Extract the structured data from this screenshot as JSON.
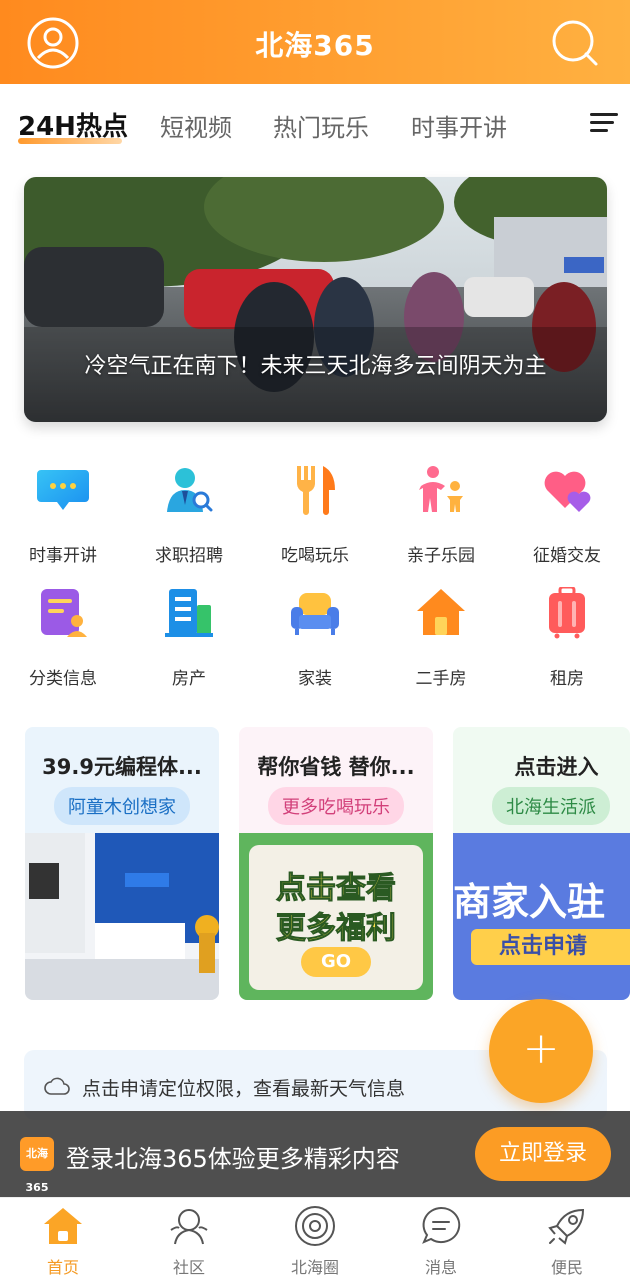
{
  "header": {
    "title": "北海365",
    "icons": [
      "user-icon",
      "search-icon"
    ]
  },
  "tabs": {
    "items": [
      {
        "label": "24H热点",
        "active": true
      },
      {
        "label": "短视频",
        "active": false
      },
      {
        "label": "热门玩乐",
        "active": false
      },
      {
        "label": "时事开讲",
        "active": false
      }
    ],
    "menu_icon": "menu-icon"
  },
  "banner": {
    "caption": "冷空气正在南下！未来三天北海多云间阴天为主"
  },
  "categories": [
    {
      "label": "时事开讲",
      "icon": "chat-bubble-icon"
    },
    {
      "label": "求职招聘",
      "icon": "job-search-icon"
    },
    {
      "label": "吃喝玩乐",
      "icon": "fork-knife-icon"
    },
    {
      "label": "亲子乐园",
      "icon": "parent-child-icon"
    },
    {
      "label": "征婚交友",
      "icon": "hearts-icon"
    },
    {
      "label": "分类信息",
      "icon": "classified-icon"
    },
    {
      "label": "房产",
      "icon": "building-icon"
    },
    {
      "label": "家装",
      "icon": "sofa-icon"
    },
    {
      "label": "二手房",
      "icon": "house-icon"
    },
    {
      "label": "租房",
      "icon": "luggage-icon"
    }
  ],
  "promos": [
    {
      "title": "39.9元编程体...",
      "tag": "阿童木创想家"
    },
    {
      "title": "帮你省钱 替你...",
      "tag": "更多吃喝玩乐",
      "image_text_1": "点击查看",
      "image_text_2": "更多福利",
      "image_button": "GO"
    },
    {
      "title": "点击进入",
      "tag": "北海生活派",
      "image_text_1": "商家入驻",
      "image_button": "点击申请"
    }
  ],
  "weather": {
    "text": "点击申请定位权限，查看最新天气信息",
    "icon": "cloud-icon"
  },
  "fab": {
    "label": "+"
  },
  "login_bar": {
    "logo_text": "北海365",
    "text": "登录北海365体验更多精彩内容",
    "button": "立即登录"
  },
  "bottom_nav": [
    {
      "label": "首页",
      "icon": "home-icon",
      "active": true
    },
    {
      "label": "社区",
      "icon": "community-icon",
      "active": false
    },
    {
      "label": "北海圈",
      "icon": "circle-icon",
      "active": false
    },
    {
      "label": "消息",
      "icon": "message-icon",
      "active": false
    },
    {
      "label": "便民",
      "icon": "rocket-icon",
      "active": false
    }
  ],
  "colors": {
    "brand_orange": "#ff9a2e",
    "active_nav": "#f59a23"
  }
}
